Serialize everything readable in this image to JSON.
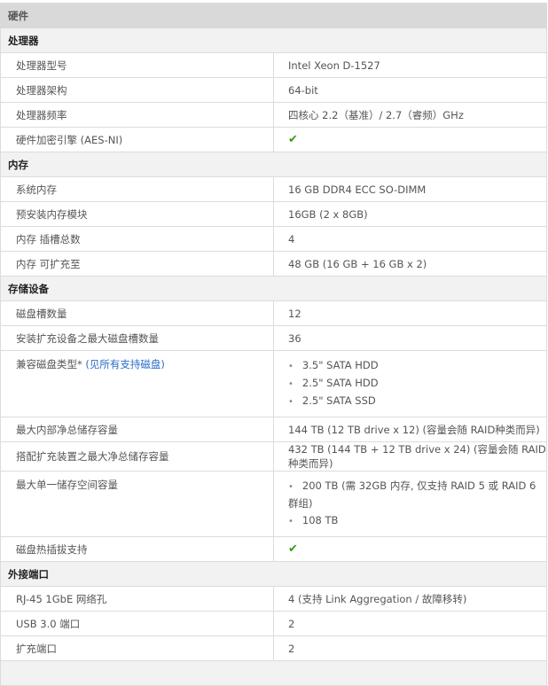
{
  "title": "硬件",
  "sections": [
    {
      "name": "处理器",
      "rows": [
        {
          "k": "处理器型号",
          "v": "Intel Xeon D-1527"
        },
        {
          "k": "处理器架构",
          "v": "64-bit"
        },
        {
          "k": "处理器频率",
          "v": "四核心 2.2（基准）/ 2.7（睿频）GHz"
        },
        {
          "k": "硬件加密引擎 (AES-NI)",
          "check": true
        }
      ]
    },
    {
      "name": "内存",
      "rows": [
        {
          "k": "系统内存",
          "v": "16 GB DDR4 ECC SO-DIMM"
        },
        {
          "k": "预安装内存模块",
          "v": "16GB (2 x 8GB)"
        },
        {
          "k": "内存 插槽总数",
          "v": "4"
        },
        {
          "k": "内存 可扩充至",
          "v": "48 GB (16 GB + 16 GB x 2)"
        }
      ]
    },
    {
      "name": "存储设备",
      "rows": [
        {
          "k": "磁盘槽数量",
          "v": "12"
        },
        {
          "k": "安装扩充设备之最大磁盘槽数量",
          "v": "36"
        },
        {
          "k": "兼容磁盘类型*",
          "link": "(见所有支持磁盘)",
          "list": [
            "3.5\" SATA HDD",
            "2.5\" SATA HDD",
            "2.5\" SATA SSD"
          ]
        },
        {
          "k": "最大内部净总储存容量",
          "v": "144 TB (12 TB drive x 12) (容量会随 RAID种类而异)"
        },
        {
          "k": "搭配扩充装置之最大净总储存容量",
          "v": "432 TB (144 TB + 12 TB drive x 24) (容量会随 RAID种类而异)"
        },
        {
          "k": "最大单一储存空间容量",
          "list": [
            "200 TB (需 32GB 内存, 仅支持 RAID 5 或 RAID 6 群组)",
            "108 TB"
          ]
        },
        {
          "k": "磁盘热插拔支持",
          "check": true
        }
      ]
    },
    {
      "name": "外接端口",
      "rows": [
        {
          "k": "RJ-45 1GbE 网络孔",
          "v": "4 (支持 Link Aggregation / 故障移转)"
        },
        {
          "k": "USB 3.0 端口",
          "v": "2"
        },
        {
          "k": "扩充端口",
          "v": "2"
        }
      ]
    }
  ],
  "check_icon": "checkmark-icon",
  "check_color": "#3a9a1a"
}
